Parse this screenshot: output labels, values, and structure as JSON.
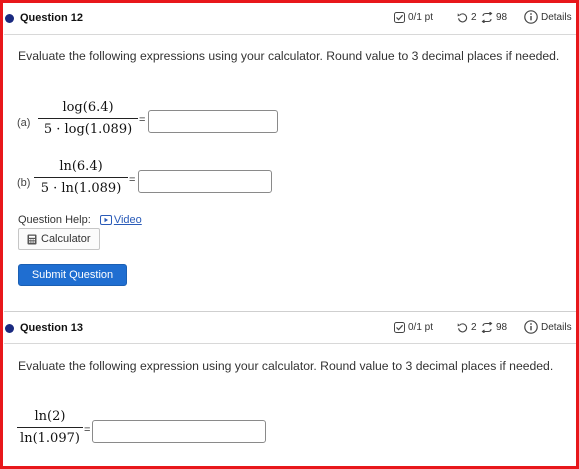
{
  "question12": {
    "title": "Question 12",
    "points": "0/1 pt",
    "retries": "2",
    "attempts": "98",
    "details": "Details",
    "prompt": "Evaluate the following expressions using your calculator. Round value to 3 decimal places if needed.",
    "part_a": {
      "label": "(a)",
      "numerator": "log(6.4)",
      "denominator": "5 · log(1.089)",
      "equals": "=",
      "answer_value": ""
    },
    "part_b": {
      "label": "(b)",
      "numerator": "ln(6.4)",
      "denominator": "5 · ln(1.089)",
      "equals": "=",
      "answer_value": ""
    },
    "help_label": "Question Help:",
    "video_label": "Video",
    "calculator_label": "Calculator",
    "submit_label": "Submit Question"
  },
  "question13": {
    "title": "Question 13",
    "points": "0/1 pt",
    "retries": "2",
    "attempts": "98",
    "details": "Details",
    "prompt": "Evaluate the following expression using your calculator. Round value to 3 decimal places if needed.",
    "numerator": "ln(2)",
    "denominator": "ln(1.097)",
    "equals": "=",
    "answer_value": ""
  },
  "colors": {
    "frame": "#e8171b",
    "bullet": "#1a2a80",
    "submit": "#1f6ed1",
    "link": "#2a5bb8"
  },
  "icons": [
    "bullet-dot-icon",
    "checkbox-score-icon",
    "retry-icon",
    "attempts-icon",
    "info-icon",
    "video-icon",
    "calculator-icon"
  ]
}
